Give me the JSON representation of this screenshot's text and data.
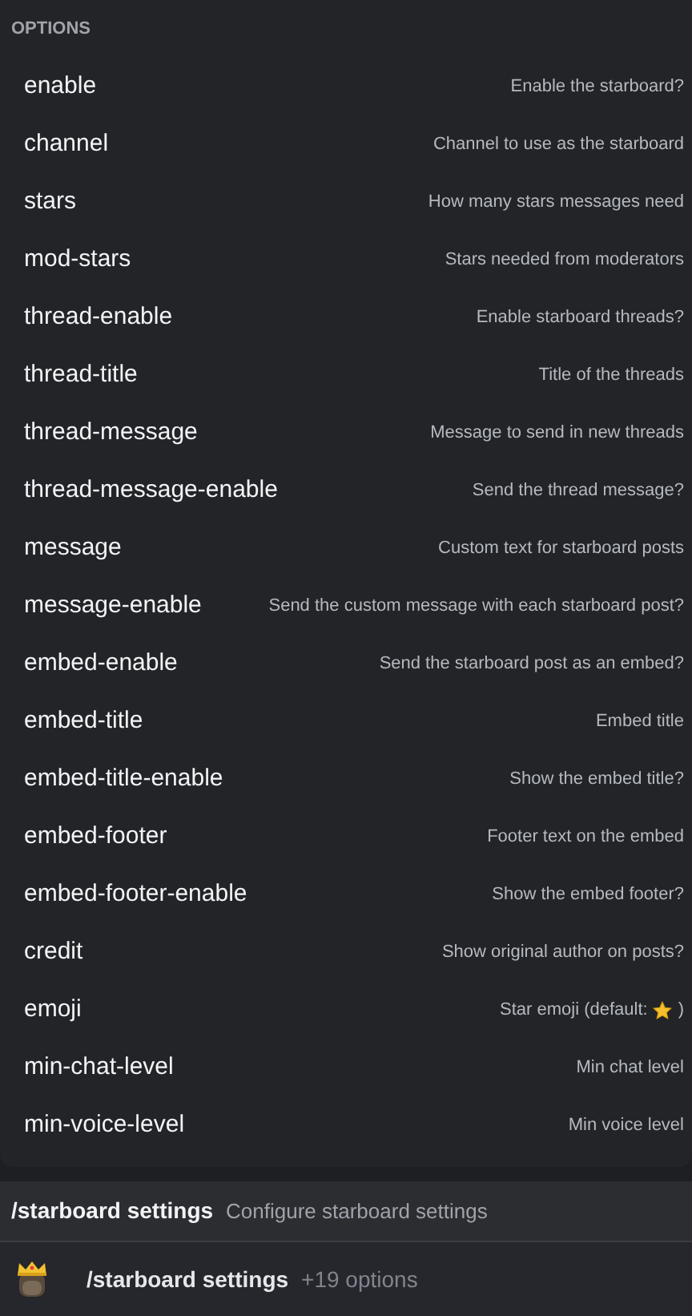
{
  "options_header": "OPTIONS",
  "options": [
    {
      "name": "enable",
      "description": "Enable the starboard?"
    },
    {
      "name": "channel",
      "description": "Channel to use as the starboard"
    },
    {
      "name": "stars",
      "description": "How many stars messages need"
    },
    {
      "name": "mod-stars",
      "description": "Stars needed from moderators"
    },
    {
      "name": "thread-enable",
      "description": "Enable starboard threads?"
    },
    {
      "name": "thread-title",
      "description": "Title of the threads"
    },
    {
      "name": "thread-message",
      "description": "Message to send in new threads"
    },
    {
      "name": "thread-message-enable",
      "description": "Send the thread message?"
    },
    {
      "name": "message",
      "description": "Custom text for starboard posts"
    },
    {
      "name": "message-enable",
      "description": "Send the custom message with each starboard post?"
    },
    {
      "name": "embed-enable",
      "description": "Send the starboard post as an embed?"
    },
    {
      "name": "embed-title",
      "description": "Embed title"
    },
    {
      "name": "embed-title-enable",
      "description": "Show the embed title?"
    },
    {
      "name": "embed-footer",
      "description": "Footer text on the embed"
    },
    {
      "name": "embed-footer-enable",
      "description": "Show the embed footer?"
    },
    {
      "name": "credit",
      "description": "Show original author on posts?"
    },
    {
      "name": "emoji",
      "description": "Star emoji (default:",
      "description_end": ")",
      "kind": "emoji"
    },
    {
      "name": "min-chat-level",
      "description": "Min chat level"
    },
    {
      "name": "min-voice-level",
      "description": "Min voice level"
    }
  ],
  "command_bar": {
    "command": "/starboard settings",
    "description": "Configure starboard settings"
  },
  "selected_command": {
    "command": "/starboard settings",
    "count": "+19 options"
  }
}
